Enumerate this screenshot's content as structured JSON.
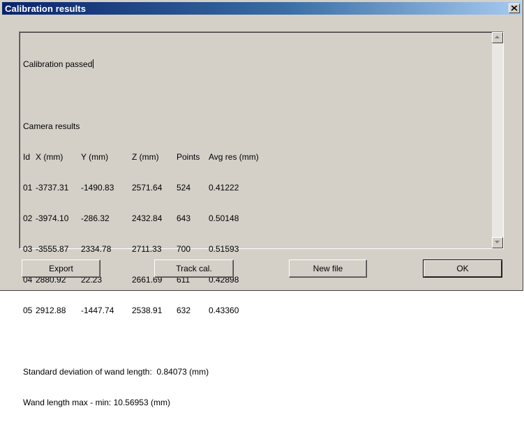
{
  "window": {
    "title": "Calibration results",
    "close_glyph": "×"
  },
  "text": {
    "status_line": "Calibration passed",
    "camera_heading": "Camera results",
    "columns": [
      "Id",
      "X (mm)",
      "Y (mm)",
      "Z (mm)",
      "Points",
      "Avg res (mm)"
    ],
    "rows": [
      [
        "01",
        "-3737.31",
        "-1490.83",
        "2571.64",
        "524",
        "0.41222"
      ],
      [
        "02",
        "-3974.10",
        "-286.32",
        "2432.84",
        "643",
        "0.50148"
      ],
      [
        "03",
        "-3555.87",
        "2334.78",
        "2711.33",
        "700",
        "0.51593"
      ],
      [
        "04",
        "2880.92",
        "22.23",
        "2661.69",
        "611",
        "0.42898"
      ],
      [
        "05",
        "2912.88",
        "-1447.74",
        "2538.91",
        "632",
        "0.43360"
      ]
    ],
    "std_dev_line": "Standard deviation of wand length:  0.84073 (mm)",
    "max_min_line": "Wand length max - min: 10.56953 (mm)"
  },
  "buttons": {
    "export": "Export",
    "track_cal": "Track cal.",
    "new_file": "New file",
    "ok": "OK"
  }
}
